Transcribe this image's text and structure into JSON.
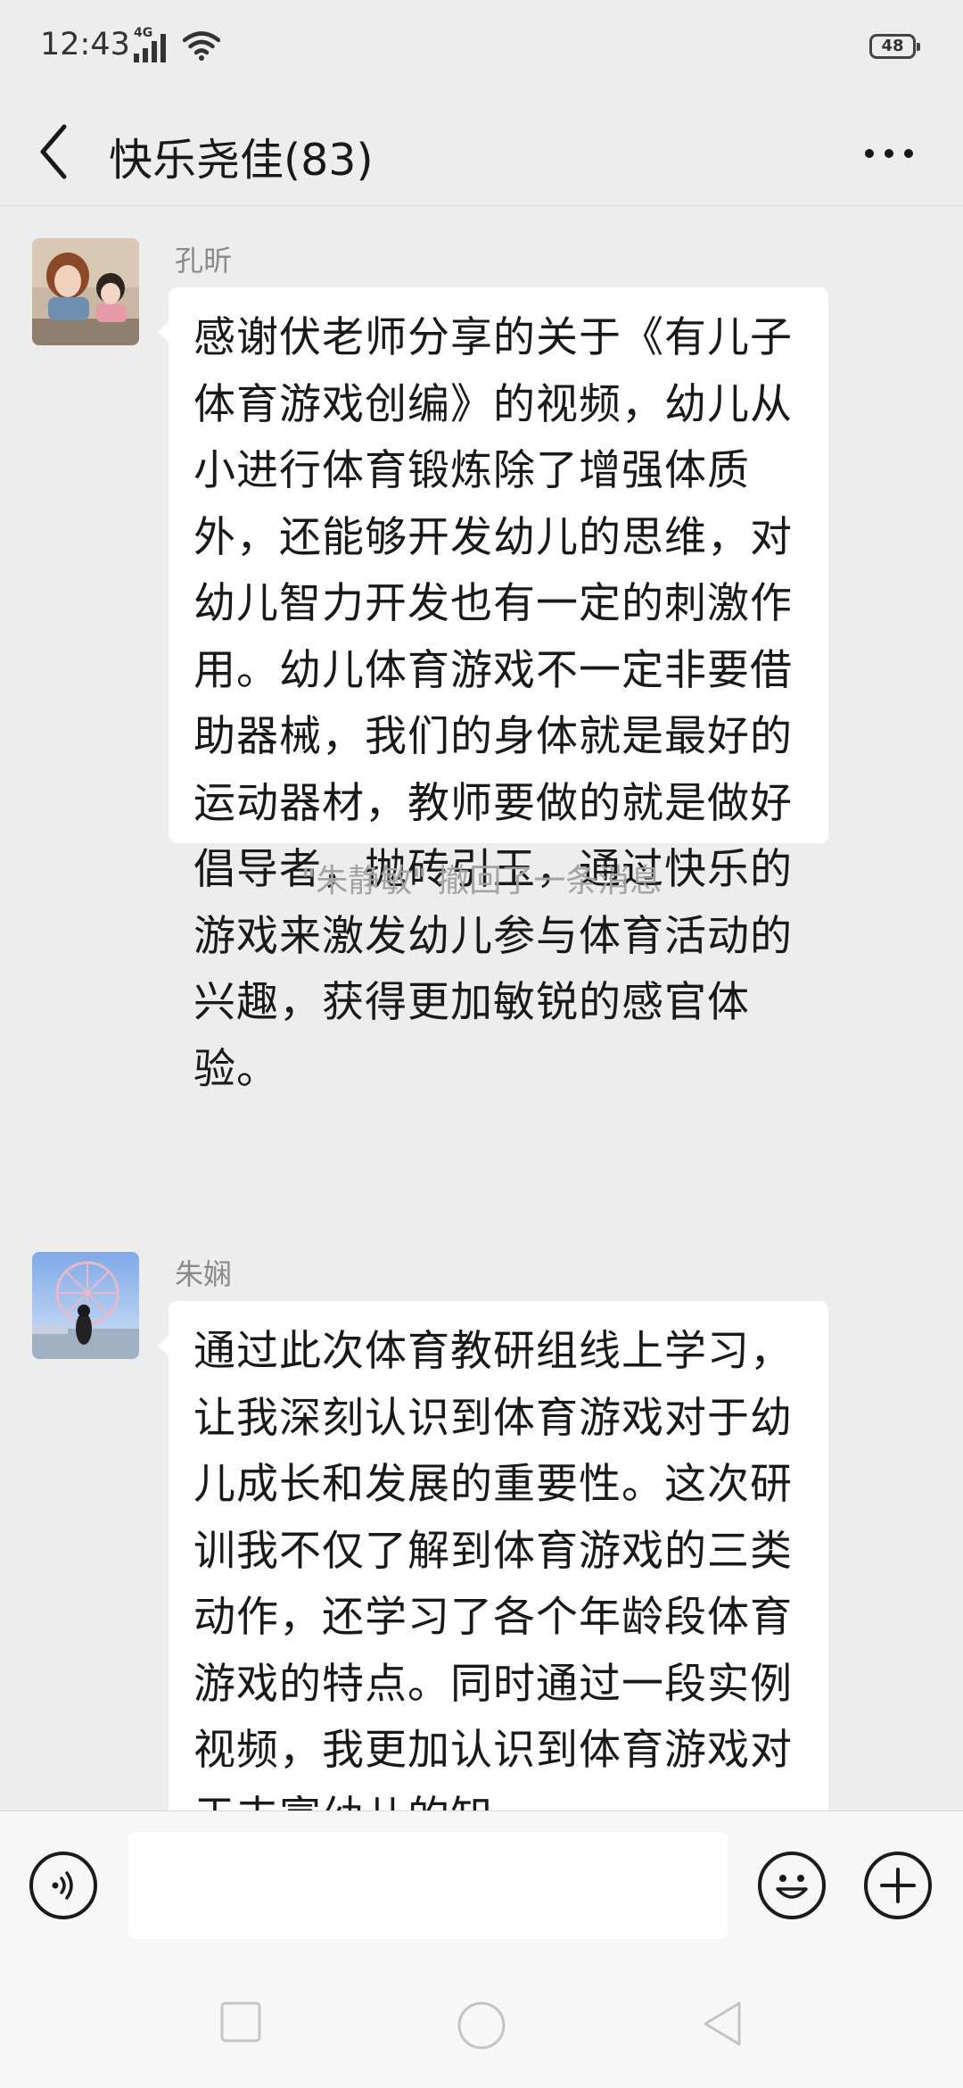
{
  "status_bar": {
    "time": "12:43",
    "network": "4G",
    "battery": "48"
  },
  "header": {
    "title": "快乐尧佳(83)"
  },
  "messages": [
    {
      "sender": "孔昕",
      "text": "感谢伏老师分享的关于《有儿子体育游戏创编》的视频，幼儿从小进行体育锻炼除了增强体质外，还能够开发幼儿的思维，对幼儿智力开发也有一定的刺激作用。幼儿体育游戏不一定非要借助器械，我们的身体就是最好的运动器材，教师要做的就是做好倡导者，抛砖引玉，通过快乐的游戏来激发幼儿参与体育活动的兴趣，获得更加敏锐的感官体验。"
    },
    {
      "system": "\"朱静敏\" 撤回了一条消息"
    },
    {
      "sender": "朱娴",
      "text": "通过此次体育教研组线上学习，让我深刻认识到体育游戏对于幼儿成长和发展的重要性。这次研训我不仅了解到体育游戏的三类动作，还学习了各个年龄段体育游戏的特点。同时通过一段实例视频，我更加认识到体育游戏对于丰富幼儿的知"
    }
  ],
  "input_bar": {
    "placeholder": ""
  },
  "icons": {
    "back": "back-arrow-icon",
    "more": "more-dots-icon",
    "voice": "voice-icon",
    "emoji": "emoji-icon",
    "add": "plus-icon",
    "nav_recent": "square-icon",
    "nav_home": "circle-icon",
    "nav_back": "triangle-icon"
  }
}
